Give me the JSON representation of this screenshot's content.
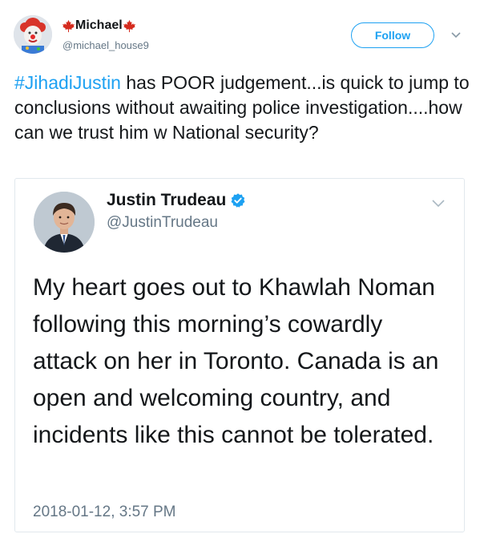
{
  "tweet": {
    "author": {
      "display_name": "Michael",
      "handle": "@michael_house9"
    },
    "follow_label": "Follow",
    "hashtag": "#JihadiJustin",
    "body_text": " has POOR judgement...is quick to jump to conclusions without awaiting police investigation....how can we trust him w National security?"
  },
  "quoted_tweet": {
    "author": {
      "display_name": "Justin Trudeau",
      "handle": "@JustinTrudeau",
      "verified": true
    },
    "text": "My heart goes out to Khawlah Noman following this morning’s cowardly attack on her in Toronto. Canada is an open and welcoming country, and incidents like this cannot be tolerated.",
    "timestamp": "2018-01-12, 3:57 PM"
  },
  "icons": {
    "maple_leaf": "maple-leaf-icon",
    "verified": "verified-badge-icon",
    "caret": "chevron-down-icon"
  },
  "colors": {
    "accent": "#1da1f2",
    "secondary_text": "#657786",
    "maple_red": "#d52b1e"
  }
}
